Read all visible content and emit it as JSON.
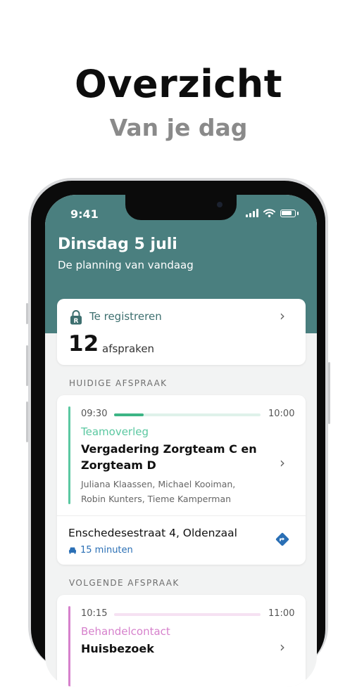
{
  "hero": {
    "title": "Overzicht",
    "subtitle": "Van je dag"
  },
  "status_bar": {
    "time": "9:41"
  },
  "header": {
    "title": "Dinsdag 5 juli",
    "subtitle": "De planning van vandaag"
  },
  "register_card": {
    "label": "Te registreren",
    "count": "12",
    "unit": "afspraken",
    "icon": "lock-r-icon"
  },
  "current": {
    "section_label": "HUIDIGE AFSPRAAK",
    "start": "09:30",
    "end": "10:00",
    "progress": 0.2,
    "category": "Teamoverleg",
    "title_line1": "Vergadering Zorgteam C en",
    "title_line2": "Zorgteam D",
    "people_line1": "Juliana Klaassen, Michael Kooiman,",
    "people_line2": "Robin Kunters, Tieme Kamperman",
    "address": "Enschedesestraat 4, Oldenzaal",
    "travel": "15 minuten",
    "travel_icon": "car-icon",
    "route_icon": "directions-icon"
  },
  "next": {
    "section_label": "VOLGENDE AFSPRAAK",
    "start": "10:15",
    "end": "11:00",
    "progress": 0,
    "category": "Behandelcontact",
    "title_line1": "Huisbezoek"
  },
  "colors": {
    "header_bg": "#4a7f7f",
    "teal_text": "#3d6f6f",
    "current_accent": "#5bc8a1",
    "next_accent": "#d681cc",
    "link_blue": "#2a6fb5"
  }
}
